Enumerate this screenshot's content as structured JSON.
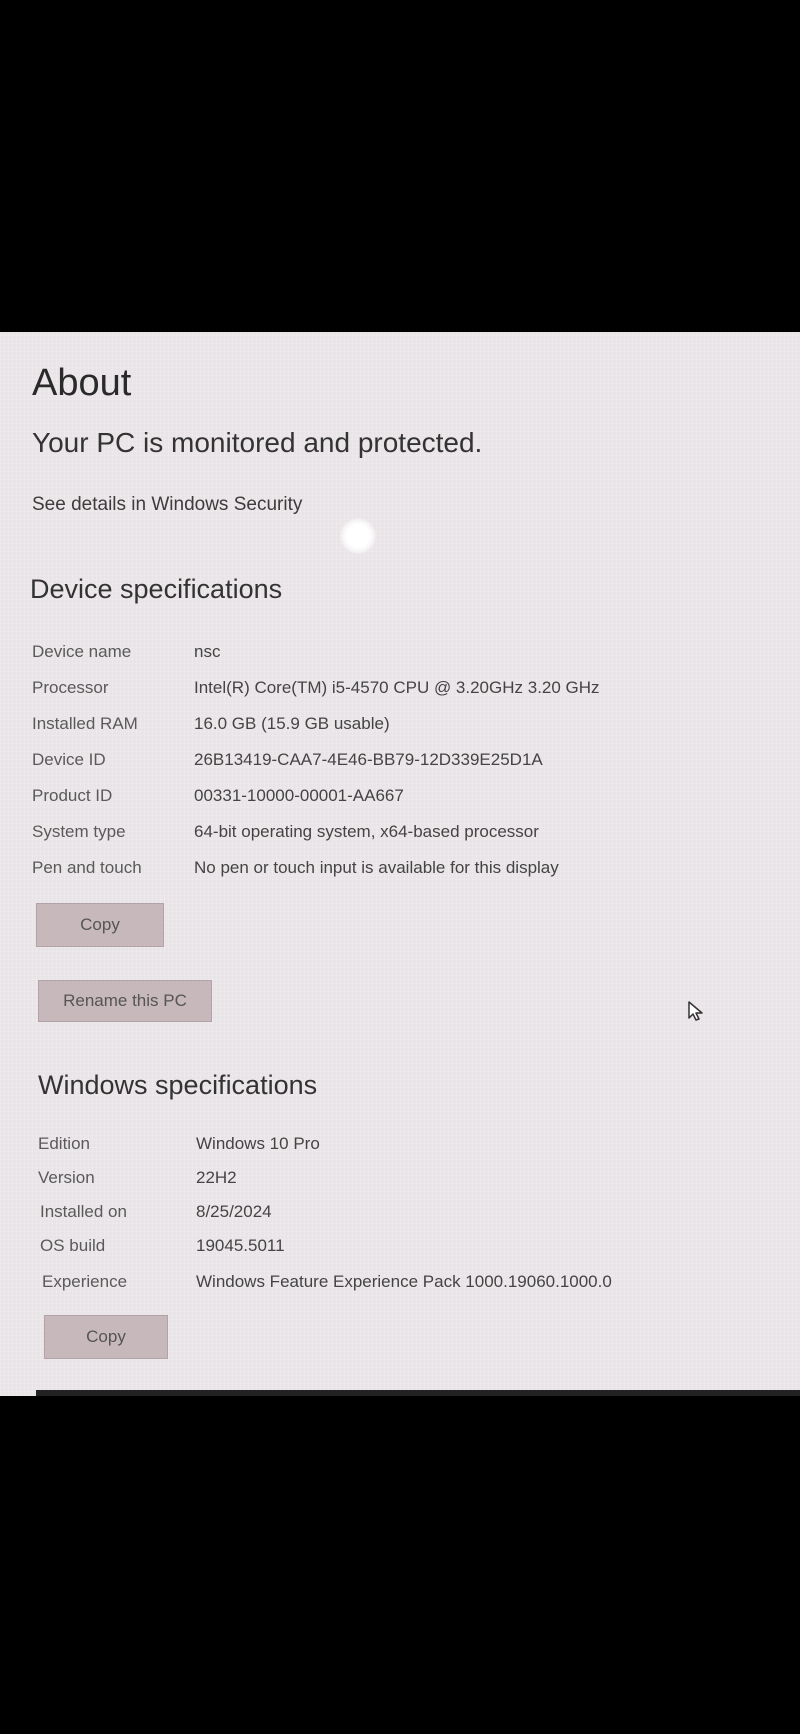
{
  "page": {
    "title": "About",
    "status_heading": "Your PC is monitored and protected.",
    "security_link": "See details in Windows Security"
  },
  "device": {
    "heading": "Device specifications",
    "rows": [
      {
        "label": "Device name",
        "value": "nsc"
      },
      {
        "label": "Processor",
        "value": "Intel(R) Core(TM) i5-4570 CPU @ 3.20GHz   3.20 GHz"
      },
      {
        "label": "Installed RAM",
        "value": "16.0 GB (15.9 GB usable)"
      },
      {
        "label": "Device ID",
        "value": "26B13419-CAA7-4E46-BB79-12D339E25D1A"
      },
      {
        "label": "Product ID",
        "value": "00331-10000-00001-AA667"
      },
      {
        "label": "System type",
        "value": "64-bit operating system, x64-based processor"
      },
      {
        "label": "Pen and touch",
        "value": "No pen or touch input is available for this display"
      }
    ],
    "copy_label": "Copy",
    "rename_label": "Rename this PC"
  },
  "windows": {
    "heading": "Windows specifications",
    "rows": [
      {
        "label": "Edition",
        "value": "Windows 10 Pro"
      },
      {
        "label": "Version",
        "value": "22H2"
      },
      {
        "label": "Installed on",
        "value": "8/25/2024"
      },
      {
        "label": "OS build",
        "value": "19045.5011"
      },
      {
        "label": "Experience",
        "value": "Windows Feature Experience Pack 1000.19060.1000.0"
      }
    ],
    "copy_label": "Copy"
  },
  "icons": {
    "cursor": "mouse-pointer-icon"
  }
}
